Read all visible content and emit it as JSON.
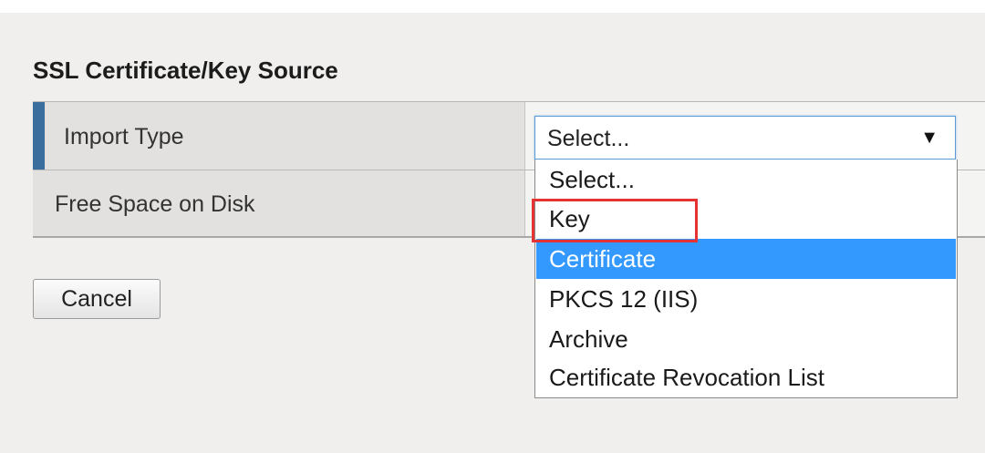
{
  "section": {
    "title": "SSL Certificate/Key Source"
  },
  "form": {
    "rows": [
      {
        "label": "Import Type"
      },
      {
        "label": "Free Space on Disk"
      }
    ]
  },
  "import_type_select": {
    "selected_value": "Select...",
    "arrow_glyph": "▼",
    "options": [
      "Select...",
      "Key",
      "Certificate",
      "PKCS 12 (IIS)",
      "Archive",
      "Certificate Revocation List"
    ],
    "hovered_option": "Certificate",
    "highlighted_option": "Key"
  },
  "actions": {
    "cancel_label": "Cancel"
  },
  "colors": {
    "accent_bar": "#3a6e9e",
    "option_hover": "#3399ff",
    "annotation_box": "#e53333"
  }
}
